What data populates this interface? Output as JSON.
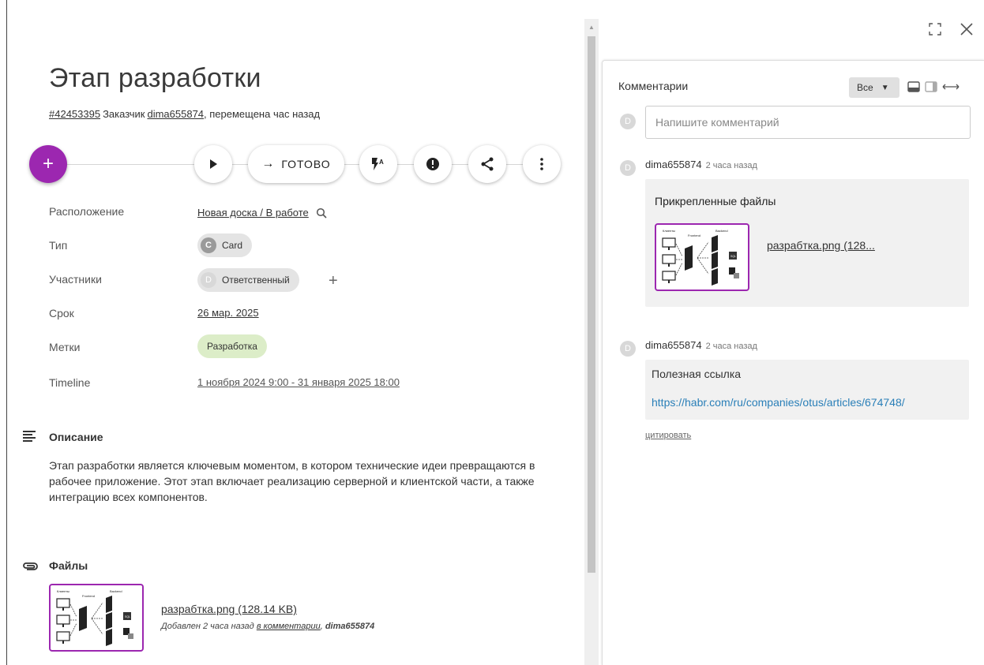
{
  "card": {
    "title": "Этап разработки",
    "id": "#42453395",
    "client_label": "Заказчик",
    "client": "dima655874",
    "moved": ", перемещена час назад"
  },
  "actions": {
    "fab": "+",
    "done_label": "ГОТОВО",
    "done_arrow": "→"
  },
  "props": {
    "location_label": "Расположение",
    "location_value": "Новая доска / В работе",
    "type_label": "Тип",
    "type_avatar": "C",
    "type_value": "Card",
    "members_label": "Участники",
    "members_avatar": "D",
    "members_value": "Ответственный",
    "members_add": "+",
    "due_label": "Срок",
    "due_value": "26 мар. 2025",
    "tags_label": "Метки",
    "tags_value": "Разработка",
    "timeline_label": "Timeline",
    "timeline_value": "1 ноября 2024 9:00 - 31 января 2025 18:00"
  },
  "description": {
    "title": "Описание",
    "text": "Этап разработки является ключевым моментом, в котором технические идеи превращаются в рабочее приложение. Этот этап включает реализацию серверной и клиентской части, а также интеграцию всех компонентов."
  },
  "files": {
    "title": "Файлы",
    "name": "разрабтка.png (128.14 KB)",
    "meta_prefix": "Добавлен 2 часа назад ",
    "meta_link": "в комментарии",
    "meta_sep": ", ",
    "meta_author": "dima655874",
    "thumb_labels": [
      "Клиенты",
      "Frontend",
      "Backend",
      "SQL"
    ]
  },
  "comments": {
    "title": "Комментарии",
    "filter": "Все",
    "placeholder": "Напишите комментарий",
    "avatar": "D",
    "items": [
      {
        "author": "dima655874",
        "time": "2 часа назад",
        "attachments_title": "Прикрепленные файлы",
        "attachment_name": "разрабтка.png (128..."
      },
      {
        "author": "dima655874",
        "time": "2 часа назад",
        "text": "Полезная ссылка",
        "url": "https://habr.com/ru/companies/otus/articles/674748/"
      }
    ],
    "quote": "цитировать"
  },
  "colors": {
    "accent": "#9c27b0",
    "tag": "#dcedc8",
    "link": "#2a7fb8"
  }
}
